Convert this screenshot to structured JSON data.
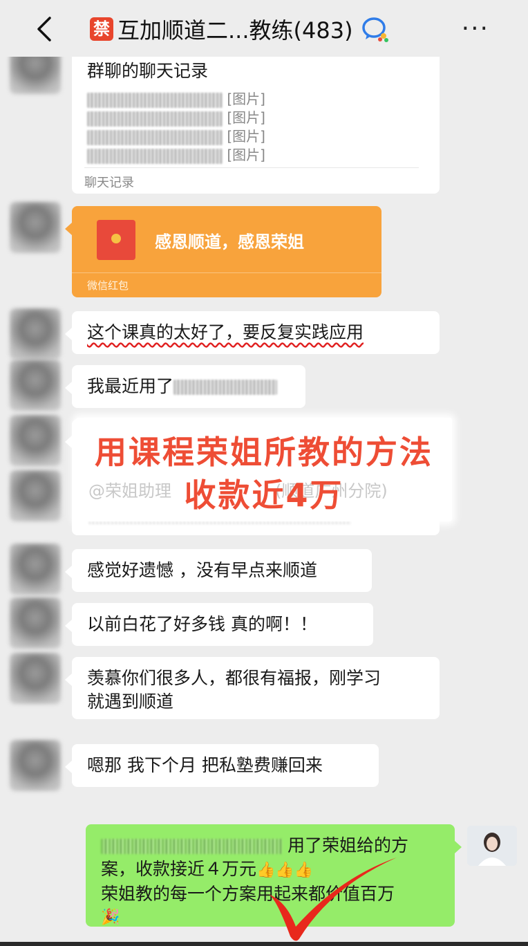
{
  "header": {
    "ban_badge": "禁",
    "title": "互加顺道二...教练(483)",
    "more": "···"
  },
  "messages": {
    "chat_record": {
      "title": "群聊的聊天记录",
      "lines": [
        "[图片]",
        "[图片]",
        "[图片]",
        "[图片]"
      ],
      "footer": "聊天记录"
    },
    "red_packet": {
      "text": "感恩顺道，感恩荣姐",
      "footer": "微信红包"
    },
    "m1": "这个课真的太好了，要反复实践应用",
    "m2": "我最近用了",
    "m3_mention": "@荣姐助理",
    "m3_tail": "(顺道广州分院)",
    "m4": "感觉好遗憾 ，没有早点来顺道",
    "m5": "以前白花了好多钱 真的啊！！",
    "m6_line1": "羡慕你们很多人，都很有福报，刚学习",
    "m6_line2": "就遇到顺道",
    "m7": "嗯那 我下个月 把私塾费赚回来",
    "mine": {
      "line1_tail": "用了荣姐给的方",
      "line2": "案，收款接近４万元",
      "line2_emoji": "👍👍👍",
      "line3": "荣姐教的每一个方案用起来都价值百万",
      "line4_emoji": "🎉"
    }
  },
  "overlay": {
    "line1": "用课程荣姐所教的方法",
    "line2": "收款近4万"
  },
  "colors": {
    "background": "#ededed",
    "bubble_other": "#ffffff",
    "bubble_mine": "#95ec69",
    "red_packet": "#f8a33c",
    "overlay_text": "#ee4d35",
    "checkmark": "#e8281c"
  }
}
